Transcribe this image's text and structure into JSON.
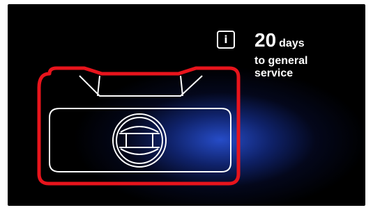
{
  "service_reminder": {
    "info_icon": "info-icon",
    "days_value": "20",
    "days_unit": "days",
    "description": "to general service"
  },
  "colors": {
    "highlight_outline": "#e8141c",
    "glow": "#2850d2",
    "line_art": "#ffffff",
    "background": "#000000"
  }
}
